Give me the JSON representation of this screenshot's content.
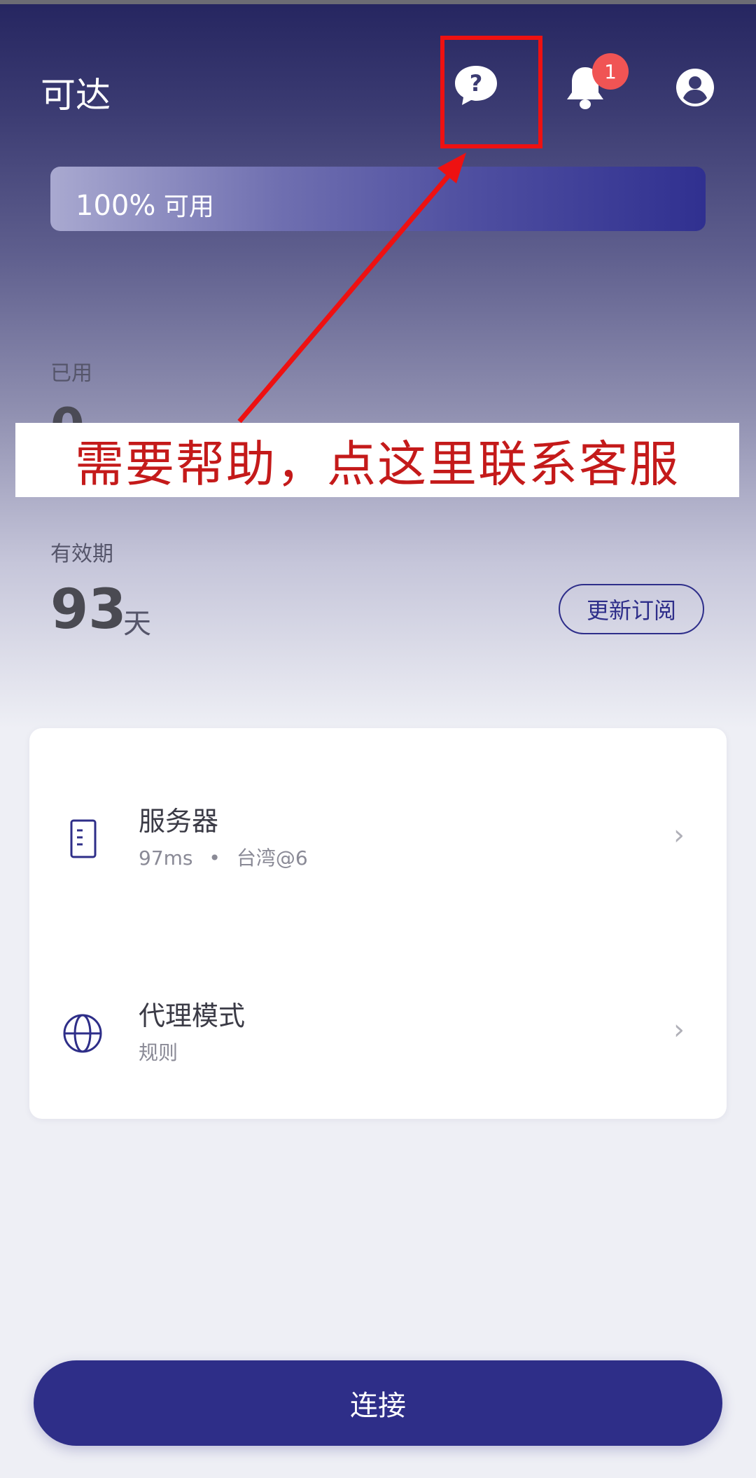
{
  "header": {
    "app_title": "可达",
    "notification_count": "1"
  },
  "usage": {
    "available_percent": "100%",
    "available_label": "可用",
    "available_fraction": 1.0,
    "used_label": "已用",
    "used_value": "0",
    "validity_label": "有效期",
    "validity_days": "93",
    "validity_unit": "天",
    "renew_button": "更新订阅"
  },
  "annotation": {
    "banner_text": "需要帮助，点这里联系客服",
    "color": "#ee1111"
  },
  "settings": {
    "server": {
      "title": "服务器",
      "latency": "97ms",
      "separator": "•",
      "location": "台湾@6"
    },
    "proxy_mode": {
      "title": "代理模式",
      "value": "规则"
    }
  },
  "connect_button": "连接",
  "colors": {
    "accent": "#2e2e88",
    "badge": "#f05454"
  },
  "icons": [
    "help-chat-icon",
    "bell-icon",
    "profile-icon",
    "server-icon",
    "globe-icon",
    "chevron-right-icon"
  ]
}
